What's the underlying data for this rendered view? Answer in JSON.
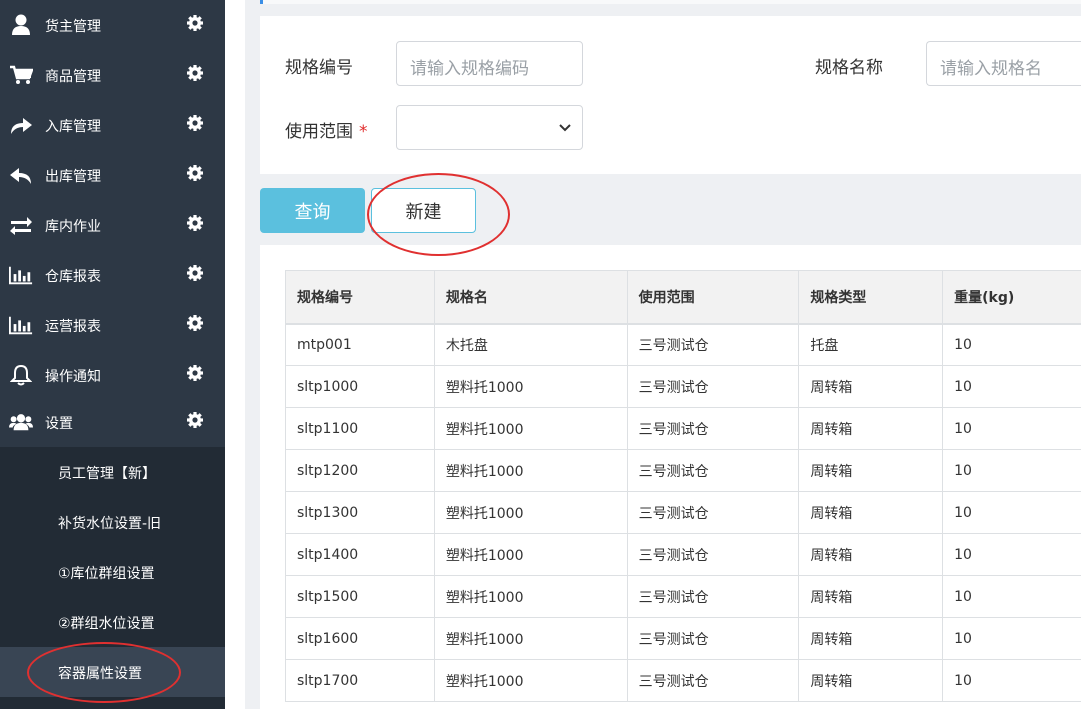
{
  "sidebar": {
    "items": [
      {
        "label": "货主管理",
        "icon": "user-icon"
      },
      {
        "label": "商品管理",
        "icon": "cart-icon"
      },
      {
        "label": "入库管理",
        "icon": "share-arrow-icon"
      },
      {
        "label": "出库管理",
        "icon": "reply-arrow-icon"
      },
      {
        "label": "库内作业",
        "icon": "exchange-icon"
      },
      {
        "label": "仓库报表",
        "icon": "bar-chart-icon"
      },
      {
        "label": "运营报表",
        "icon": "bar-chart-icon"
      },
      {
        "label": "操作通知",
        "icon": "bell-icon"
      },
      {
        "label": "设置",
        "icon": "users-icon"
      }
    ],
    "subitems": [
      {
        "label": "员工管理【新】"
      },
      {
        "label": "补货水位设置-旧"
      },
      {
        "label": "①库位群组设置"
      },
      {
        "label": "②群组水位设置"
      },
      {
        "label": "容器属性设置",
        "active": true
      }
    ]
  },
  "form": {
    "spec_code_label": "规格编号",
    "spec_code_placeholder": "请输入规格编码",
    "spec_name_label": "规格名称",
    "spec_name_placeholder": "请输入规格名",
    "scope_label": "使用范围",
    "scope_required": "*",
    "scope_value": ""
  },
  "buttons": {
    "query": "查询",
    "new": "新建"
  },
  "table": {
    "headers": [
      "规格编号",
      "规格名",
      "使用范围",
      "规格类型",
      "重量(kg)"
    ],
    "rows": [
      [
        "mtp001",
        "木托盘",
        "三号测试仓",
        "托盘",
        "10"
      ],
      [
        "sltp1000",
        "塑料托1000",
        "三号测试仓",
        "周转箱",
        "10"
      ],
      [
        "sltp1100",
        "塑料托1000",
        "三号测试仓",
        "周转箱",
        "10"
      ],
      [
        "sltp1200",
        "塑料托1000",
        "三号测试仓",
        "周转箱",
        "10"
      ],
      [
        "sltp1300",
        "塑料托1000",
        "三号测试仓",
        "周转箱",
        "10"
      ],
      [
        "sltp1400",
        "塑料托1000",
        "三号测试仓",
        "周转箱",
        "10"
      ],
      [
        "sltp1500",
        "塑料托1000",
        "三号测试仓",
        "周转箱",
        "10"
      ],
      [
        "sltp1600",
        "塑料托1000",
        "三号测试仓",
        "周转箱",
        "10"
      ],
      [
        "sltp1700",
        "塑料托1000",
        "三号测试仓",
        "周转箱",
        "10"
      ]
    ]
  },
  "colors": {
    "sidebar_bg": "#2d3845",
    "submenu_bg": "#222b35",
    "active_bg": "#394554",
    "query_button": "#5bc0de",
    "annotation_red": "#e03030"
  }
}
